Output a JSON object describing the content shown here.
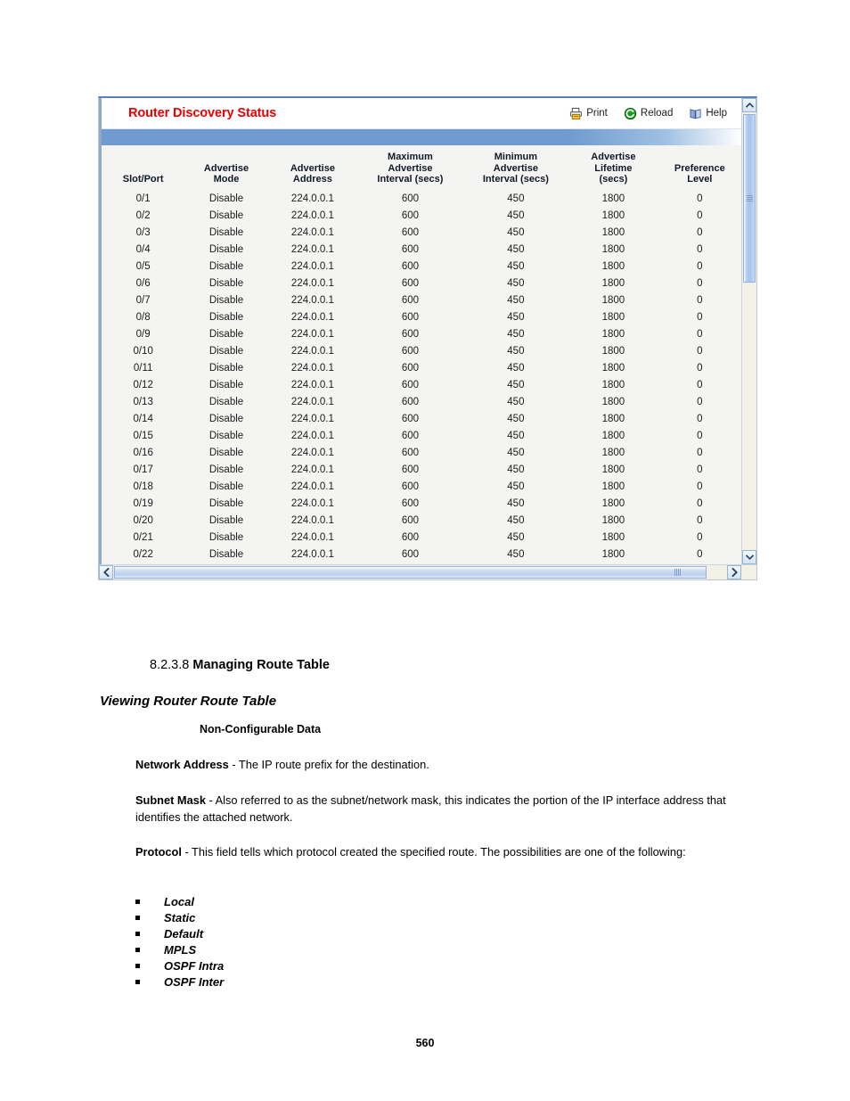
{
  "app_window": {
    "title": "Router Discovery Status",
    "title_color": "#ee0000",
    "toolbar": [
      {
        "label": "Print",
        "icon": "printer-icon"
      },
      {
        "label": "Reload",
        "icon": "reload-icon"
      },
      {
        "label": "Help",
        "icon": "help-book-icon"
      }
    ],
    "table": {
      "columns": [
        "Slot/Port",
        "Advertise Mode",
        "Advertise Address",
        "Maximum Advertise Interval (secs)",
        "Minimum Advertise Interval (secs)",
        "Advertise Lifetime (secs)",
        "Preference Level"
      ],
      "column_lines": [
        [
          "Slot/Port"
        ],
        [
          "Advertise",
          "Mode"
        ],
        [
          "Advertise",
          "Address"
        ],
        [
          "Maximum",
          "Advertise",
          "Interval (secs)"
        ],
        [
          "Minimum",
          "Advertise",
          "Interval (secs)"
        ],
        [
          "Advertise",
          "Lifetime",
          "(secs)"
        ],
        [
          "Preference",
          "Level"
        ]
      ],
      "rows": [
        [
          "0/1",
          "Disable",
          "224.0.0.1",
          "600",
          "450",
          "1800",
          "0"
        ],
        [
          "0/2",
          "Disable",
          "224.0.0.1",
          "600",
          "450",
          "1800",
          "0"
        ],
        [
          "0/3",
          "Disable",
          "224.0.0.1",
          "600",
          "450",
          "1800",
          "0"
        ],
        [
          "0/4",
          "Disable",
          "224.0.0.1",
          "600",
          "450",
          "1800",
          "0"
        ],
        [
          "0/5",
          "Disable",
          "224.0.0.1",
          "600",
          "450",
          "1800",
          "0"
        ],
        [
          "0/6",
          "Disable",
          "224.0.0.1",
          "600",
          "450",
          "1800",
          "0"
        ],
        [
          "0/7",
          "Disable",
          "224.0.0.1",
          "600",
          "450",
          "1800",
          "0"
        ],
        [
          "0/8",
          "Disable",
          "224.0.0.1",
          "600",
          "450",
          "1800",
          "0"
        ],
        [
          "0/9",
          "Disable",
          "224.0.0.1",
          "600",
          "450",
          "1800",
          "0"
        ],
        [
          "0/10",
          "Disable",
          "224.0.0.1",
          "600",
          "450",
          "1800",
          "0"
        ],
        [
          "0/11",
          "Disable",
          "224.0.0.1",
          "600",
          "450",
          "1800",
          "0"
        ],
        [
          "0/12",
          "Disable",
          "224.0.0.1",
          "600",
          "450",
          "1800",
          "0"
        ],
        [
          "0/13",
          "Disable",
          "224.0.0.1",
          "600",
          "450",
          "1800",
          "0"
        ],
        [
          "0/14",
          "Disable",
          "224.0.0.1",
          "600",
          "450",
          "1800",
          "0"
        ],
        [
          "0/15",
          "Disable",
          "224.0.0.1",
          "600",
          "450",
          "1800",
          "0"
        ],
        [
          "0/16",
          "Disable",
          "224.0.0.1",
          "600",
          "450",
          "1800",
          "0"
        ],
        [
          "0/17",
          "Disable",
          "224.0.0.1",
          "600",
          "450",
          "1800",
          "0"
        ],
        [
          "0/18",
          "Disable",
          "224.0.0.1",
          "600",
          "450",
          "1800",
          "0"
        ],
        [
          "0/19",
          "Disable",
          "224.0.0.1",
          "600",
          "450",
          "1800",
          "0"
        ],
        [
          "0/20",
          "Disable",
          "224.0.0.1",
          "600",
          "450",
          "1800",
          "0"
        ],
        [
          "0/21",
          "Disable",
          "224.0.0.1",
          "600",
          "450",
          "1800",
          "0"
        ],
        [
          "0/22",
          "Disable",
          "224.0.0.1",
          "600",
          "450",
          "1800",
          "0"
        ]
      ]
    },
    "accent_blue": "#6f9bd0"
  },
  "document": {
    "section_number": "8.2.3.8",
    "section_title": "Managing Route Table",
    "subsection_title": "Viewing Router Route Table",
    "noncfg_heading": "Non-Configurable Data",
    "paragraphs": [
      {
        "term": "Network Address",
        "text": " - The IP route prefix for the destination."
      },
      {
        "term": "Subnet Mask",
        "text": " - Also referred to as the subnet/network mask, this indicates the portion of the IP interface address that identifies the attached network."
      },
      {
        "term": "Protocol",
        "text": " - This field tells which protocol created the specified route. The possibilities are one of the following:"
      }
    ],
    "protocol_list": [
      "Local",
      "Static",
      "Default",
      "MPLS",
      "OSPF Intra",
      "OSPF Inter"
    ],
    "page_number": "560"
  }
}
